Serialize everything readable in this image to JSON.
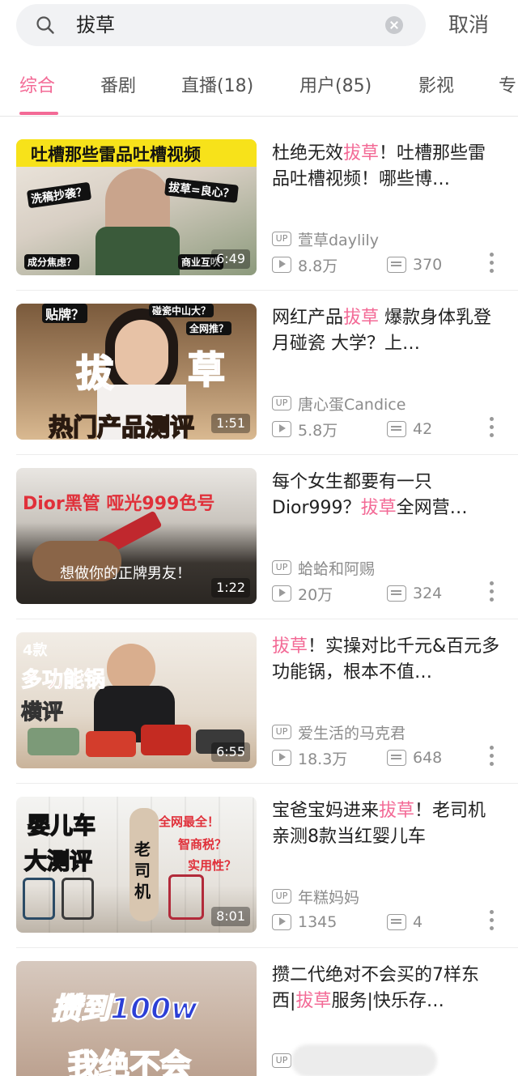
{
  "search": {
    "query": "拔草",
    "cancel_label": "取消"
  },
  "tabs": [
    {
      "label": "综合",
      "active": true
    },
    {
      "label": "番剧",
      "active": false
    },
    {
      "label": "直播(18)",
      "active": false
    },
    {
      "label": "用户(85)",
      "active": false
    },
    {
      "label": "影视",
      "active": false
    },
    {
      "label": "专",
      "active": false
    }
  ],
  "accent_color": "#f36a96",
  "videos": [
    {
      "title_parts": [
        "杜绝无效",
        "拔草",
        "！吐槽那些雷品吐槽视频！哪些博…"
      ],
      "thumb_caption": "吐槽那些雷品吐槽视频",
      "thumb_extra": [
        "洗稿抄袭？",
        "拔草=良心？",
        "成分焦虑？",
        "商业互吹"
      ],
      "duration": "6:49",
      "author": "萱草daylily",
      "views": "8.8万",
      "comments": "370"
    },
    {
      "title_parts": [
        "网红产品",
        "拔草",
        " 爆款身体乳登月碰瓷  大学？上…"
      ],
      "thumb_caption": "热门产品测评",
      "thumb_extra": [
        "拔",
        "草",
        "贴牌？",
        "碰瓷中山大？",
        "全网推？"
      ],
      "duration": "1:51",
      "author": "唐心蛋Candice",
      "views": "5.8万",
      "comments": "42"
    },
    {
      "title_parts": [
        "每个女生都要有一只Dior999？",
        "拔草",
        "全网营…"
      ],
      "thumb_caption": "Dior黑管 哑光999色号",
      "thumb_extra": [
        "想做你的正牌男友！"
      ],
      "duration": "1:22",
      "author": "蛤蛤和阿赐",
      "views": "20万",
      "comments": "324"
    },
    {
      "title_parts": [
        "",
        "拔草",
        "！实操对比千元&百元多功能锅，根本不值…"
      ],
      "thumb_caption": "多功能锅",
      "thumb_extra": [
        "4款",
        "横评"
      ],
      "duration": "6:55",
      "author": "爱生活的马克君",
      "views": "18.3万",
      "comments": "648"
    },
    {
      "title_parts": [
        "宝爸宝妈进来",
        "拔草",
        "！老司机亲测8款当红婴儿车"
      ],
      "thumb_caption": "婴儿车",
      "thumb_extra": [
        "大测评",
        "老司机",
        "全网最全！",
        "智商税？",
        "实用性？"
      ],
      "duration": "8:01",
      "author": "年糕妈妈",
      "views": "1345",
      "comments": "4"
    },
    {
      "title_parts": [
        "攒二代绝对不会买的7样东西|",
        "拔草",
        "服务|快乐存…"
      ],
      "thumb_caption": "攒到100w",
      "thumb_extra": [
        "我绝不会"
      ],
      "duration": "",
      "author": "",
      "views": "",
      "comments": ""
    }
  ]
}
